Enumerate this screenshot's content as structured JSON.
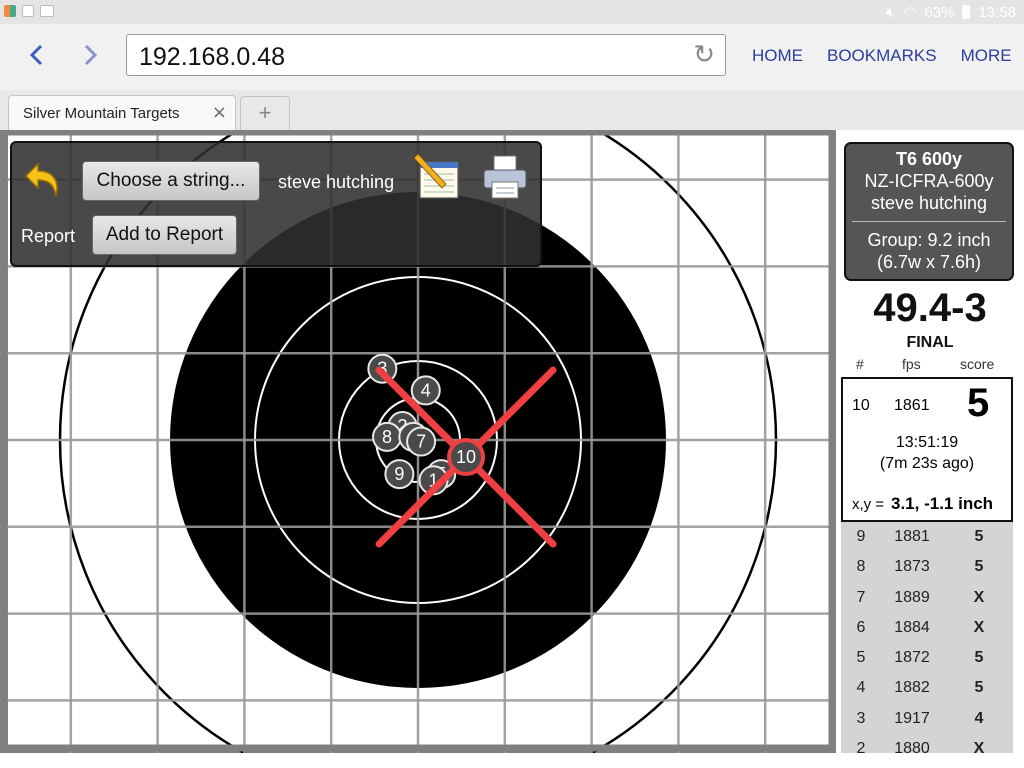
{
  "status_bar": {
    "battery": "63%",
    "time": "13:58"
  },
  "browser": {
    "back_icon": "chevron-left",
    "forward_icon": "chevron-right",
    "url": "192.168.0.48",
    "reload_icon": "reload",
    "menu": [
      "HOME",
      "BOOKMARKS",
      "MORE"
    ],
    "tab_title": "Silver Mountain Targets",
    "tab_close": "×",
    "new_tab": "+"
  },
  "toolbar": {
    "back_icon": "undo-arrow",
    "choose_string_label": "Choose a string...",
    "shooter": "steve hutching",
    "report_label": "Report",
    "add_to_report_label": "Add to Report",
    "notepad_icon": "notepad",
    "printer_icon": "printer"
  },
  "target": {
    "shots": [
      {
        "n": "3",
        "x": -2.3,
        "y": 4.6
      },
      {
        "n": "4",
        "x": 0.5,
        "y": 3.2
      },
      {
        "n": "2",
        "x": -1.0,
        "y": 0.9
      },
      {
        "n": "8",
        "x": -2.0,
        "y": 0.2
      },
      {
        "n": "6",
        "x": -0.3,
        "y": 0.2
      },
      {
        "n": "7",
        "x": 0.2,
        "y": -0.1
      },
      {
        "n": "9",
        "x": -1.2,
        "y": -2.2
      },
      {
        "n": "5",
        "x": 1.5,
        "y": -2.2
      },
      {
        "n": "1",
        "x": 1.0,
        "y": -2.6
      },
      {
        "n": "10",
        "x": 3.1,
        "y": -1.1
      }
    ]
  },
  "info": {
    "target_name": "T6 600y",
    "discipline": "NZ-ICFRA-600y",
    "shooter": "steve hutching",
    "group": "Group: 9.2 inch",
    "group_dims": "(6.7w x 7.6h)"
  },
  "total_score": "49.4-3",
  "final_label": "FINAL",
  "columns": {
    "num": "#",
    "fps": "fps",
    "score": "score"
  },
  "current_shot": {
    "num": "10",
    "fps": "1861",
    "score": "5",
    "time": "13:51:19",
    "ago": "(7m 23s ago)",
    "xy_prefix": "x,y = ",
    "xy_value": "3.1, -1.1 inch"
  },
  "shots_list": [
    {
      "num": "9",
      "fps": "1881",
      "score": "5"
    },
    {
      "num": "8",
      "fps": "1873",
      "score": "5"
    },
    {
      "num": "7",
      "fps": "1889",
      "score": "X"
    },
    {
      "num": "6",
      "fps": "1884",
      "score": "X"
    },
    {
      "num": "5",
      "fps": "1872",
      "score": "5"
    },
    {
      "num": "4",
      "fps": "1882",
      "score": "5"
    },
    {
      "num": "3",
      "fps": "1917",
      "score": "4"
    },
    {
      "num": "2",
      "fps": "1880",
      "score": "X"
    }
  ],
  "colors": {
    "accent": "#3b5fc0",
    "crosshair": "#ee4040"
  }
}
